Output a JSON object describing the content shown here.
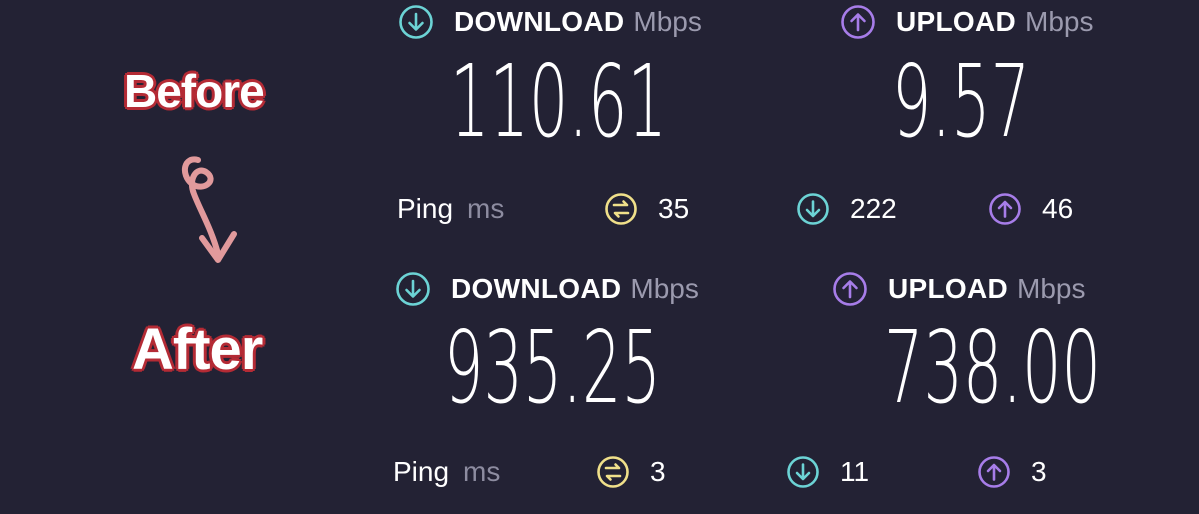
{
  "annotations": {
    "before": "Before",
    "after": "After"
  },
  "colors": {
    "background": "#232234",
    "download_accent": "#6cd3d5",
    "upload_accent": "#a77de9",
    "ping_accent": "#f0e08a",
    "annotation_outline": "#b42b35",
    "arrow_doodle": "#e19a9c"
  },
  "before": {
    "download": {
      "icon": "download-arrow-icon",
      "label": "DOWNLOAD",
      "unit": "Mbps",
      "value": "110.61"
    },
    "upload": {
      "icon": "upload-arrow-icon",
      "label": "UPLOAD",
      "unit": "Mbps",
      "value": "9.57"
    },
    "ping": {
      "label": "Ping",
      "unit": "ms",
      "idle": {
        "icon": "ping-idle-icon",
        "value": "35"
      },
      "download": {
        "icon": "download-arrow-icon",
        "value": "222"
      },
      "upload": {
        "icon": "upload-arrow-icon",
        "value": "46"
      }
    }
  },
  "after": {
    "download": {
      "icon": "download-arrow-icon",
      "label": "DOWNLOAD",
      "unit": "Mbps",
      "value": "935.25"
    },
    "upload": {
      "icon": "upload-arrow-icon",
      "label": "UPLOAD",
      "unit": "Mbps",
      "value": "738.00"
    },
    "ping": {
      "label": "Ping",
      "unit": "ms",
      "idle": {
        "icon": "ping-idle-icon",
        "value": "3"
      },
      "download": {
        "icon": "download-arrow-icon",
        "value": "11"
      },
      "upload": {
        "icon": "upload-arrow-icon",
        "value": "3"
      }
    }
  }
}
